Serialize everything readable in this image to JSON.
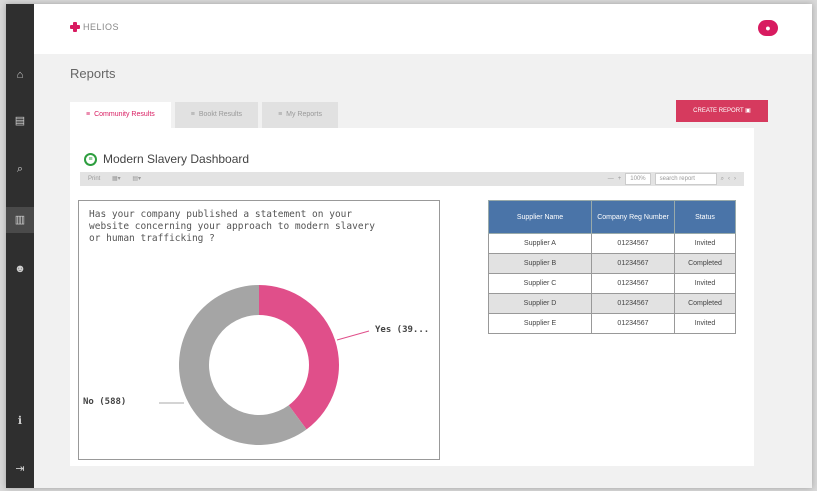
{
  "app": {
    "logo_text": "HELIOS"
  },
  "sidebar": {
    "icons": [
      "home-icon",
      "document-icon",
      "search-icon",
      "reports-icon",
      "users-icon",
      "info-icon",
      "logout-icon"
    ]
  },
  "page": {
    "title": "Reports"
  },
  "tabs": [
    {
      "label": "Community Results",
      "icon": "≡"
    },
    {
      "label": "Bookt Results",
      "icon": "≡"
    },
    {
      "label": "My Reports",
      "icon": "≡"
    }
  ],
  "create_button": {
    "label": "CREATE REPORT"
  },
  "dashboard": {
    "title": "Modern Slavery Dashboard"
  },
  "toolbar": {
    "left": [
      "Print",
      "▦▾",
      "▤▾"
    ],
    "zoom": "100%",
    "search_placeholder": "search report"
  },
  "chart": {
    "question": "Has your company published a statement on your website concerning your approach to modern slavery or human trafficking ?",
    "yes_label": "Yes (39...",
    "no_label": "No (588)"
  },
  "chart_data": {
    "type": "pie",
    "categories": [
      "Yes",
      "No"
    ],
    "values": [
      390,
      588
    ],
    "colors": [
      "#e04f8a",
      "#a5a5a5"
    ]
  },
  "table": {
    "headers": [
      "Supplier Name",
      "Company Reg Number",
      "Status"
    ],
    "rows": [
      [
        "Supplier A",
        "01234567",
        "Invited"
      ],
      [
        "Supplier B",
        "01234567",
        "Completed"
      ],
      [
        "Supplier C",
        "01234567",
        "Invited"
      ],
      [
        "Supplier D",
        "01234567",
        "Completed"
      ],
      [
        "Supplier E",
        "01234567",
        "Invited"
      ]
    ]
  }
}
